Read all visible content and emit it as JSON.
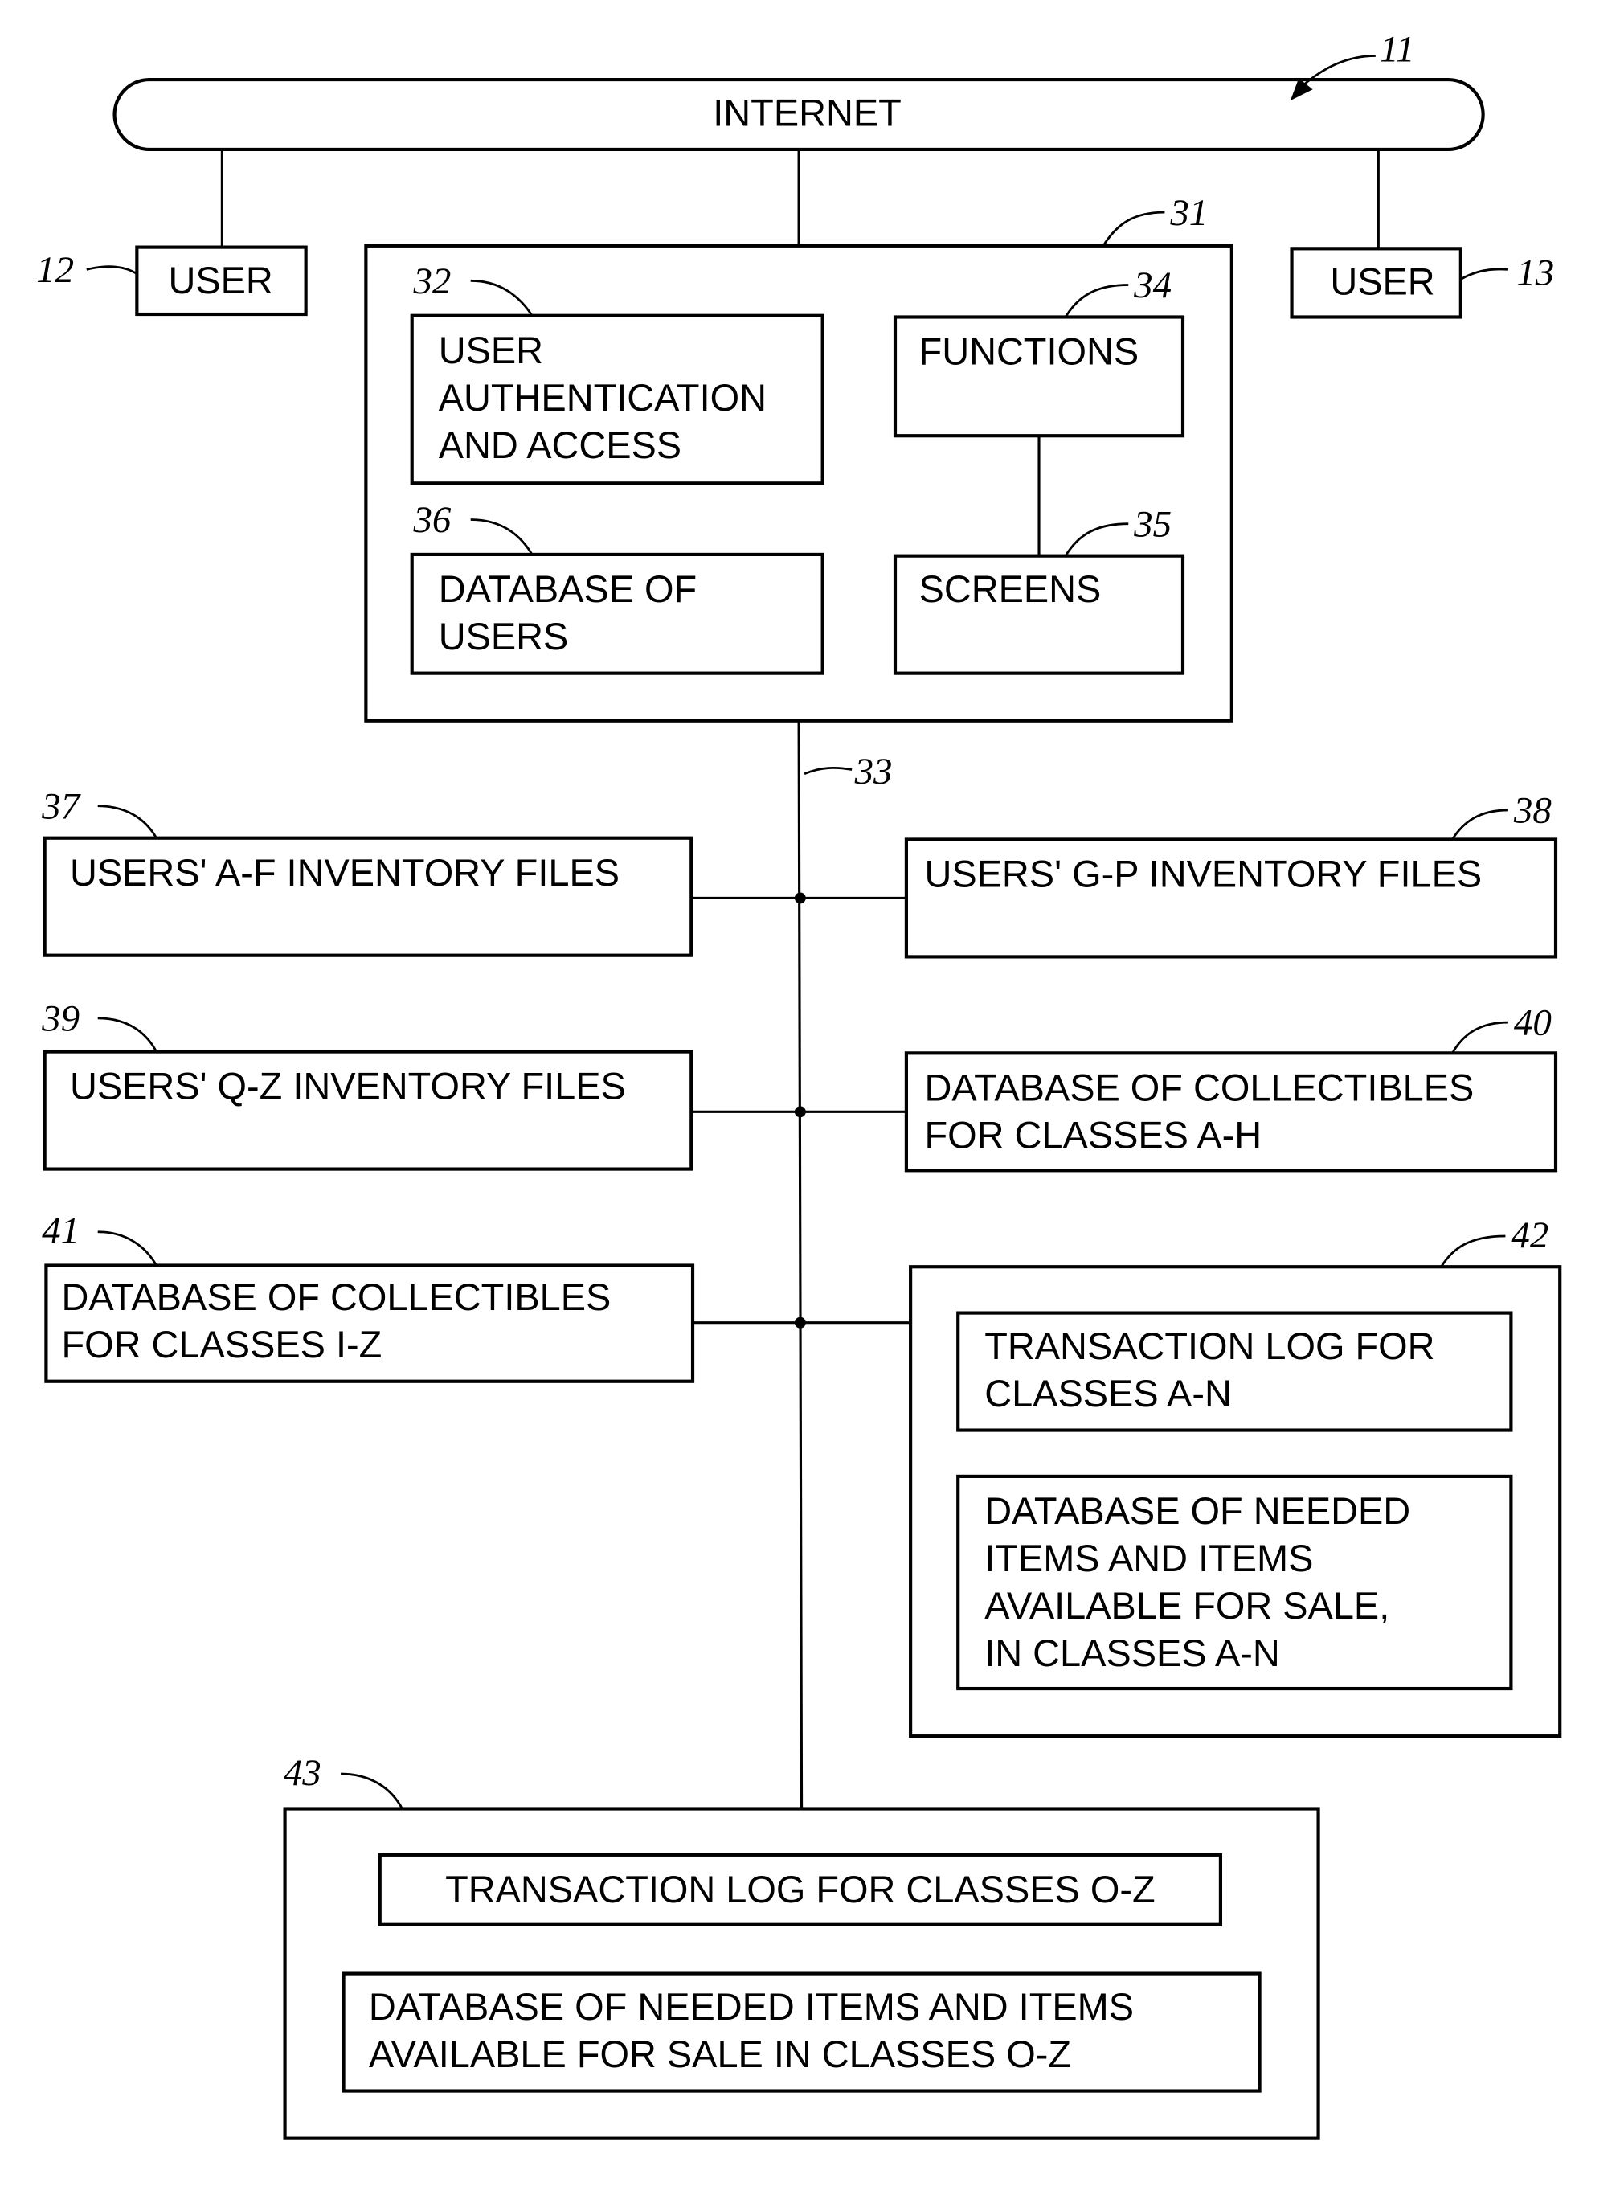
{
  "diagram": {
    "internet": {
      "ref": "11",
      "label": "INTERNET"
    },
    "user_left": {
      "ref": "12",
      "label": "USER"
    },
    "user_right": {
      "ref": "13",
      "label": "USER"
    },
    "server": {
      "ref": "31",
      "auth": {
        "ref": "32",
        "lines": [
          "USER",
          "AUTHENTICATION",
          "AND ACCESS"
        ]
      },
      "functions": {
        "ref": "34",
        "lines": [
          "FUNCTIONS"
        ]
      },
      "user_db": {
        "ref": "36",
        "lines": [
          "DATABASE OF",
          "USERS"
        ]
      },
      "screens": {
        "ref": "35",
        "lines": [
          "SCREENS"
        ]
      }
    },
    "bus": {
      "ref": "33"
    },
    "inv_af": {
      "ref": "37",
      "lines": [
        "USERS' A-F INVENTORY FILES"
      ]
    },
    "inv_gp": {
      "ref": "38",
      "lines": [
        "USERS' G-P INVENTORY FILES"
      ]
    },
    "inv_qz": {
      "ref": "39",
      "lines": [
        "USERS' Q-Z INVENTORY FILES"
      ]
    },
    "coll_ah": {
      "ref": "40",
      "lines": [
        "DATABASE OF COLLECTIBLES",
        "FOR CLASSES A-H"
      ]
    },
    "coll_iz": {
      "ref": "41",
      "lines": [
        "DATABASE OF COLLECTIBLES",
        "FOR CLASSES I-Z"
      ]
    },
    "group_an": {
      "ref": "42",
      "log": {
        "lines": [
          "TRANSACTION LOG FOR",
          "CLASSES A-N"
        ]
      },
      "needed": {
        "lines": [
          "DATABASE OF NEEDED",
          "ITEMS AND ITEMS",
          "AVAILABLE FOR SALE,",
          "IN CLASSES A-N"
        ]
      }
    },
    "group_oz": {
      "ref": "43",
      "log": {
        "lines": [
          "TRANSACTION LOG FOR CLASSES O-Z"
        ]
      },
      "needed": {
        "lines": [
          "DATABASE OF NEEDED ITEMS AND ITEMS",
          "AVAILABLE FOR SALE IN CLASSES O-Z"
        ]
      }
    }
  }
}
